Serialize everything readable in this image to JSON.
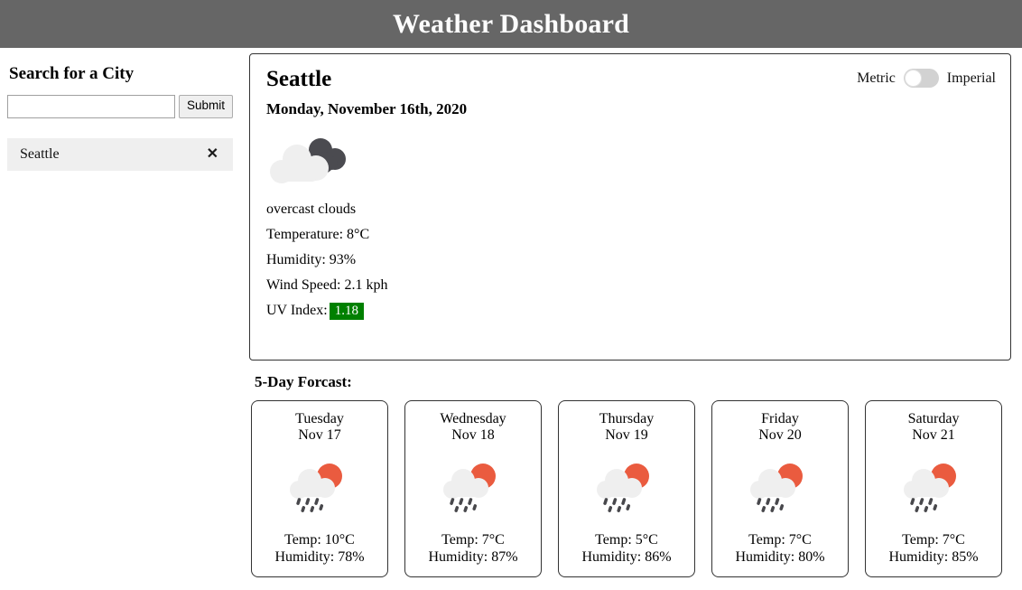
{
  "header": {
    "title": "Weather Dashboard"
  },
  "sidebar": {
    "search_heading": "Search for a City",
    "search_value": "",
    "search_placeholder": "",
    "submit_label": "Submit",
    "history": [
      {
        "name": "Seattle",
        "delete_icon": "close-x-icon",
        "delete_glyph": "✕"
      }
    ]
  },
  "current": {
    "city": "Seattle",
    "date": "Monday, November 16th, 2020",
    "units": {
      "metric_label": "Metric",
      "imperial_label": "Imperial",
      "active": "Metric"
    },
    "icon": "overcast-clouds-icon",
    "condition": "overcast clouds",
    "temperature": "Temperature: 8°C",
    "humidity": "Humidity: 93%",
    "wind_speed": "Wind Speed: 2.1 kph",
    "uv_label": "UV Index:",
    "uv_value": "1.18",
    "uv_color": "#008000"
  },
  "forecast": {
    "heading": "5-Day Forcast:",
    "days": [
      {
        "weekday": "Tuesday",
        "date": "Nov 17",
        "icon": "sun-behind-rain-cloud-icon",
        "temp": "Temp: 10°C",
        "humidity": "Humidity: 78%"
      },
      {
        "weekday": "Wednesday",
        "date": "Nov 18",
        "icon": "sun-behind-rain-cloud-icon",
        "temp": "Temp: 7°C",
        "humidity": "Humidity: 87%"
      },
      {
        "weekday": "Thursday",
        "date": "Nov 19",
        "icon": "sun-behind-rain-cloud-icon",
        "temp": "Temp: 5°C",
        "humidity": "Humidity: 86%"
      },
      {
        "weekday": "Friday",
        "date": "Nov 20",
        "icon": "sun-behind-rain-cloud-icon",
        "temp": "Temp: 7°C",
        "humidity": "Humidity: 80%"
      },
      {
        "weekday": "Saturday",
        "date": "Nov 21",
        "icon": "sun-behind-rain-cloud-icon",
        "temp": "Temp: 7°C",
        "humidity": "Humidity: 85%"
      }
    ]
  },
  "colors": {
    "header_bg": "#666666",
    "header_text": "#fdfdfd",
    "history_bg": "#efefef",
    "sun": "#ea5b3f",
    "cloud_light": "#efefef",
    "cloud_dark": "#4b4b50",
    "raindrop": "#48484c",
    "uv_green": "#008000"
  }
}
